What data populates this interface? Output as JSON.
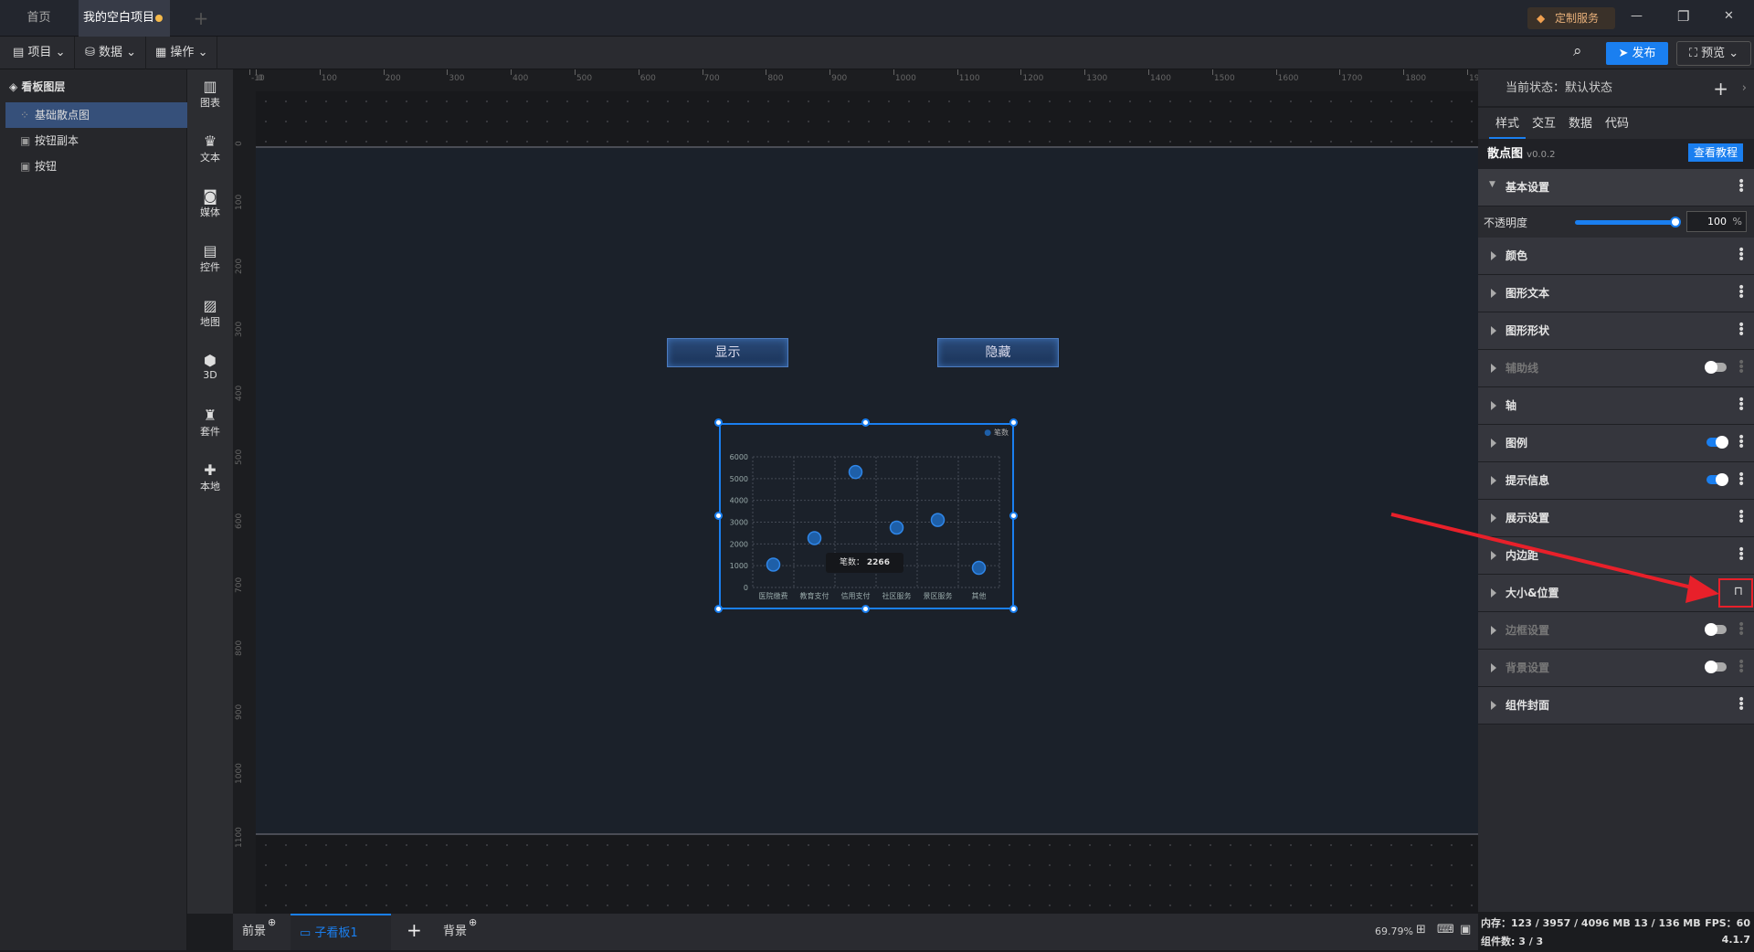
{
  "tabs": [
    {
      "label": "首页"
    },
    {
      "label": "我的空白项目",
      "unsaved": true
    }
  ],
  "window": {
    "service_label": "定制服务",
    "minimize": "—",
    "restore": "❐",
    "close": "✕"
  },
  "toolbar": {
    "menus": [
      {
        "label": "项目",
        "icon": "file-icon"
      },
      {
        "label": "数据",
        "icon": "database-icon"
      },
      {
        "label": "操作",
        "icon": "grid-icon"
      }
    ],
    "publish": "发布",
    "preview": "预览"
  },
  "layers": {
    "title": "看板图层",
    "items": [
      {
        "label": "基础散点图",
        "selected": true
      },
      {
        "label": "按钮副本"
      },
      {
        "label": "按钮"
      }
    ]
  },
  "iconbar": [
    {
      "label": "图表",
      "glyph": "▥"
    },
    {
      "label": "文本",
      "glyph": "♛"
    },
    {
      "label": "媒体",
      "glyph": "◙"
    },
    {
      "label": "控件",
      "glyph": "▤"
    },
    {
      "label": "地图",
      "glyph": "▨"
    },
    {
      "label": "3D",
      "glyph": "⬢"
    },
    {
      "label": "套件",
      "glyph": "♜"
    },
    {
      "label": "本地",
      "glyph": "✚"
    }
  ],
  "ruler": {
    "h": [
      "-10",
      "0",
      "100",
      "200",
      "300",
      "400",
      "500",
      "600",
      "700",
      "800",
      "900",
      "1000",
      "1100",
      "1200",
      "1300",
      "1400",
      "1500",
      "1600",
      "1700",
      "1800",
      "1900"
    ],
    "v": [
      "0",
      "100",
      "200",
      "300",
      "400",
      "500",
      "600",
      "700",
      "800",
      "900",
      "1000",
      "1100"
    ]
  },
  "canvas": {
    "show_button": "显示",
    "hide_button": "隐藏"
  },
  "chart_data": {
    "type": "scatter",
    "categories": [
      "医院缴费",
      "教育支付",
      "信用支付",
      "社区服务",
      "景区服务",
      "其他"
    ],
    "series": [
      {
        "name": "笔数",
        "values": [
          1050,
          2266,
          5300,
          2750,
          3100,
          900
        ]
      }
    ],
    "ylim": [
      0,
      6000
    ],
    "yticks": [
      "0",
      "1000",
      "2000",
      "3000",
      "4000",
      "5000",
      "6000"
    ],
    "grid": true,
    "legend": "top-right",
    "tooltip": {
      "label": "笔数：",
      "value": "2266"
    },
    "color": "#1e5fa8"
  },
  "right": {
    "state_label": "当前状态：默认状态",
    "tabs": [
      "样式",
      "交互",
      "数据",
      "代码"
    ],
    "component": "散点图",
    "version": "v0.0.2",
    "tutorial": "查看教程",
    "basic": "基本设置",
    "opacity_label": "不透明度",
    "opacity_value": "100",
    "opacity_unit": "%",
    "sections": [
      {
        "label": "颜色"
      },
      {
        "label": "图形文本"
      },
      {
        "label": "图形形状"
      },
      {
        "label": "辅助线",
        "toggle": false,
        "dim": true
      },
      {
        "label": "轴"
      },
      {
        "label": "图例",
        "toggle": true
      },
      {
        "label": "提示信息",
        "toggle": true
      },
      {
        "label": "展示设置"
      },
      {
        "label": "内边距"
      },
      {
        "label": "大小&位置",
        "lock": true
      },
      {
        "label": "边框设置",
        "toggle": false,
        "dim": true
      },
      {
        "label": "背景设置",
        "toggle": false,
        "dim": true
      },
      {
        "label": "组件封面"
      }
    ]
  },
  "bottom": {
    "front": "前景",
    "board": "子看板1",
    "add": "+",
    "back": "背景",
    "zoom": "69.79%"
  },
  "status": {
    "memory": "内存：123 / 3957 / 4096 MB  13 / 136 MB",
    "fps": "FPS：60",
    "components": "组件数: 3 / 3",
    "version": "4.1.7"
  },
  "colors": {
    "accent": "#1a7ff0",
    "annotation": "#e8202a"
  }
}
